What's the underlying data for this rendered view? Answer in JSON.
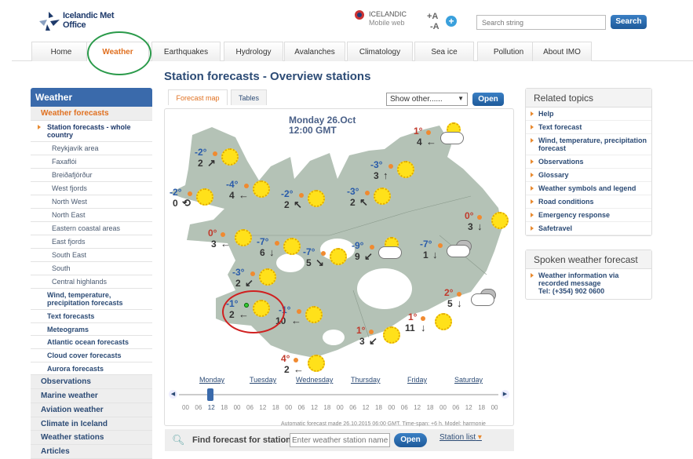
{
  "header": {
    "logo_line1": "Icelandic Met",
    "logo_line2": "Office",
    "lang": "ICELANDIC",
    "mobile": "Mobile web",
    "font_up": "+A",
    "font_down": "-A",
    "search_placeholder": "Search string",
    "search_button": "Search"
  },
  "nav": [
    {
      "label": "Home"
    },
    {
      "label": "Weather",
      "active": true
    },
    {
      "label": "Earthquakes"
    },
    {
      "label": "Hydrology"
    },
    {
      "label": "Avalanches"
    },
    {
      "label": "Climatology"
    },
    {
      "label": "Sea ice"
    },
    {
      "label": "Pollution"
    },
    {
      "label": "About IMO"
    }
  ],
  "page_title": "Station forecasts - Overview stations",
  "sidebar": {
    "header": "Weather",
    "section": "Weather forecasts",
    "current": "Station forecasts - whole country",
    "regions": [
      "Reykjavík area",
      "Faxaflói",
      "Breiðafjörður",
      "West fjords",
      "North West",
      "North East",
      "Eastern coastal areas",
      "East fjords",
      "South East",
      "South",
      "Central highlands"
    ],
    "forecasts": [
      "Wind, temperature, precipitation forecasts",
      "Text forecasts",
      "Meteograms",
      "Atlantic ocean forecasts",
      "Cloud cover forecasts",
      "Aurora forecasts"
    ],
    "top": [
      "Observations",
      "Marine weather",
      "Aviation weather",
      "Climate in Iceland",
      "Weather stations",
      "Articles"
    ]
  },
  "map": {
    "tabs": [
      "Forecast map",
      "Tables"
    ],
    "active_tab": "Forecast map",
    "show_other": "Show other......",
    "open": "Open",
    "date": "Monday 26.Oct",
    "time": "12:00 GMT",
    "colors": {
      "negative": "#2a5caa",
      "positive": "#c0392b",
      "land": "#b4c2b6"
    },
    "stations": [
      {
        "temp": "-2°",
        "wind": "2",
        "dir": "↗",
        "icon": "sun"
      },
      {
        "temp": "-2°",
        "wind": "0",
        "dir": "⟲",
        "icon": "sun"
      },
      {
        "temp": "-4°",
        "wind": "4",
        "dir": "←",
        "icon": "sun"
      },
      {
        "temp": "-2°",
        "wind": "2",
        "dir": "↖",
        "icon": "sun"
      },
      {
        "temp": "-3°",
        "wind": "2",
        "dir": "↖",
        "icon": "sun"
      },
      {
        "temp": "-3°",
        "wind": "3",
        "dir": "↑",
        "icon": "sun"
      },
      {
        "temp": "1°",
        "wind": "4",
        "dir": "←",
        "icon": "partly-cloudy"
      },
      {
        "temp": "0°",
        "wind": "3",
        "dir": "↓",
        "icon": "sun"
      },
      {
        "temp": "0°",
        "wind": "3",
        "dir": "←",
        "icon": "sun"
      },
      {
        "temp": "-7°",
        "wind": "6",
        "dir": "↓",
        "icon": "sun"
      },
      {
        "temp": "-7°",
        "wind": "5",
        "dir": "↘",
        "icon": "sun"
      },
      {
        "temp": "-9°",
        "wind": "9",
        "dir": "↙",
        "icon": "partly-cloudy"
      },
      {
        "temp": "-7°",
        "wind": "1",
        "dir": "↓",
        "icon": "cloudy"
      },
      {
        "temp": "-3°",
        "wind": "2",
        "dir": "↙",
        "icon": "sun"
      },
      {
        "temp": "-1°",
        "wind": "2",
        "dir": "←",
        "icon": "sun",
        "selected": true
      },
      {
        "temp": "-1°",
        "wind": "10",
        "dir": "←",
        "icon": "sun"
      },
      {
        "temp": "2°",
        "wind": "5",
        "dir": "↓",
        "icon": "cloudy"
      },
      {
        "temp": "1°",
        "wind": "11",
        "dir": "↓",
        "icon": "sun"
      },
      {
        "temp": "1°",
        "wind": "3",
        "dir": "↙",
        "icon": "sun"
      },
      {
        "temp": "4°",
        "wind": "2",
        "dir": "←",
        "icon": "sun"
      }
    ]
  },
  "timeline": {
    "days": [
      "Monday",
      "Tuesday",
      "Wednesday",
      "Thursday",
      "Friday",
      "Saturday"
    ],
    "hours": [
      "00",
      "06",
      "12",
      "18",
      "00",
      "06",
      "12",
      "18",
      "00",
      "06",
      "12",
      "18",
      "00",
      "06",
      "12",
      "18",
      "00",
      "06",
      "12",
      "18",
      "00",
      "06",
      "12",
      "18",
      "00"
    ],
    "selected_index": 2,
    "note": "Automatic forecast made 26.10.2015 06:00 GMT. Time-span: +6 h. Model: harmonie"
  },
  "find": {
    "label": "Find forecast for station",
    "placeholder": "Enter weather station name",
    "open": "Open",
    "station_list": "Station list"
  },
  "related": {
    "title": "Related topics",
    "items": [
      "Help",
      "Text forecast",
      "Wind, temperature, precipitation forecast",
      "Observations",
      "Glossary",
      "Weather symbols and legend",
      "Road conditions",
      "Emergency response",
      "Safetravel"
    ]
  },
  "spoken": {
    "title": "Spoken weather forecast",
    "line1": "Weather information via recorded message",
    "line2": "Tel: (+354) 902 0600"
  }
}
